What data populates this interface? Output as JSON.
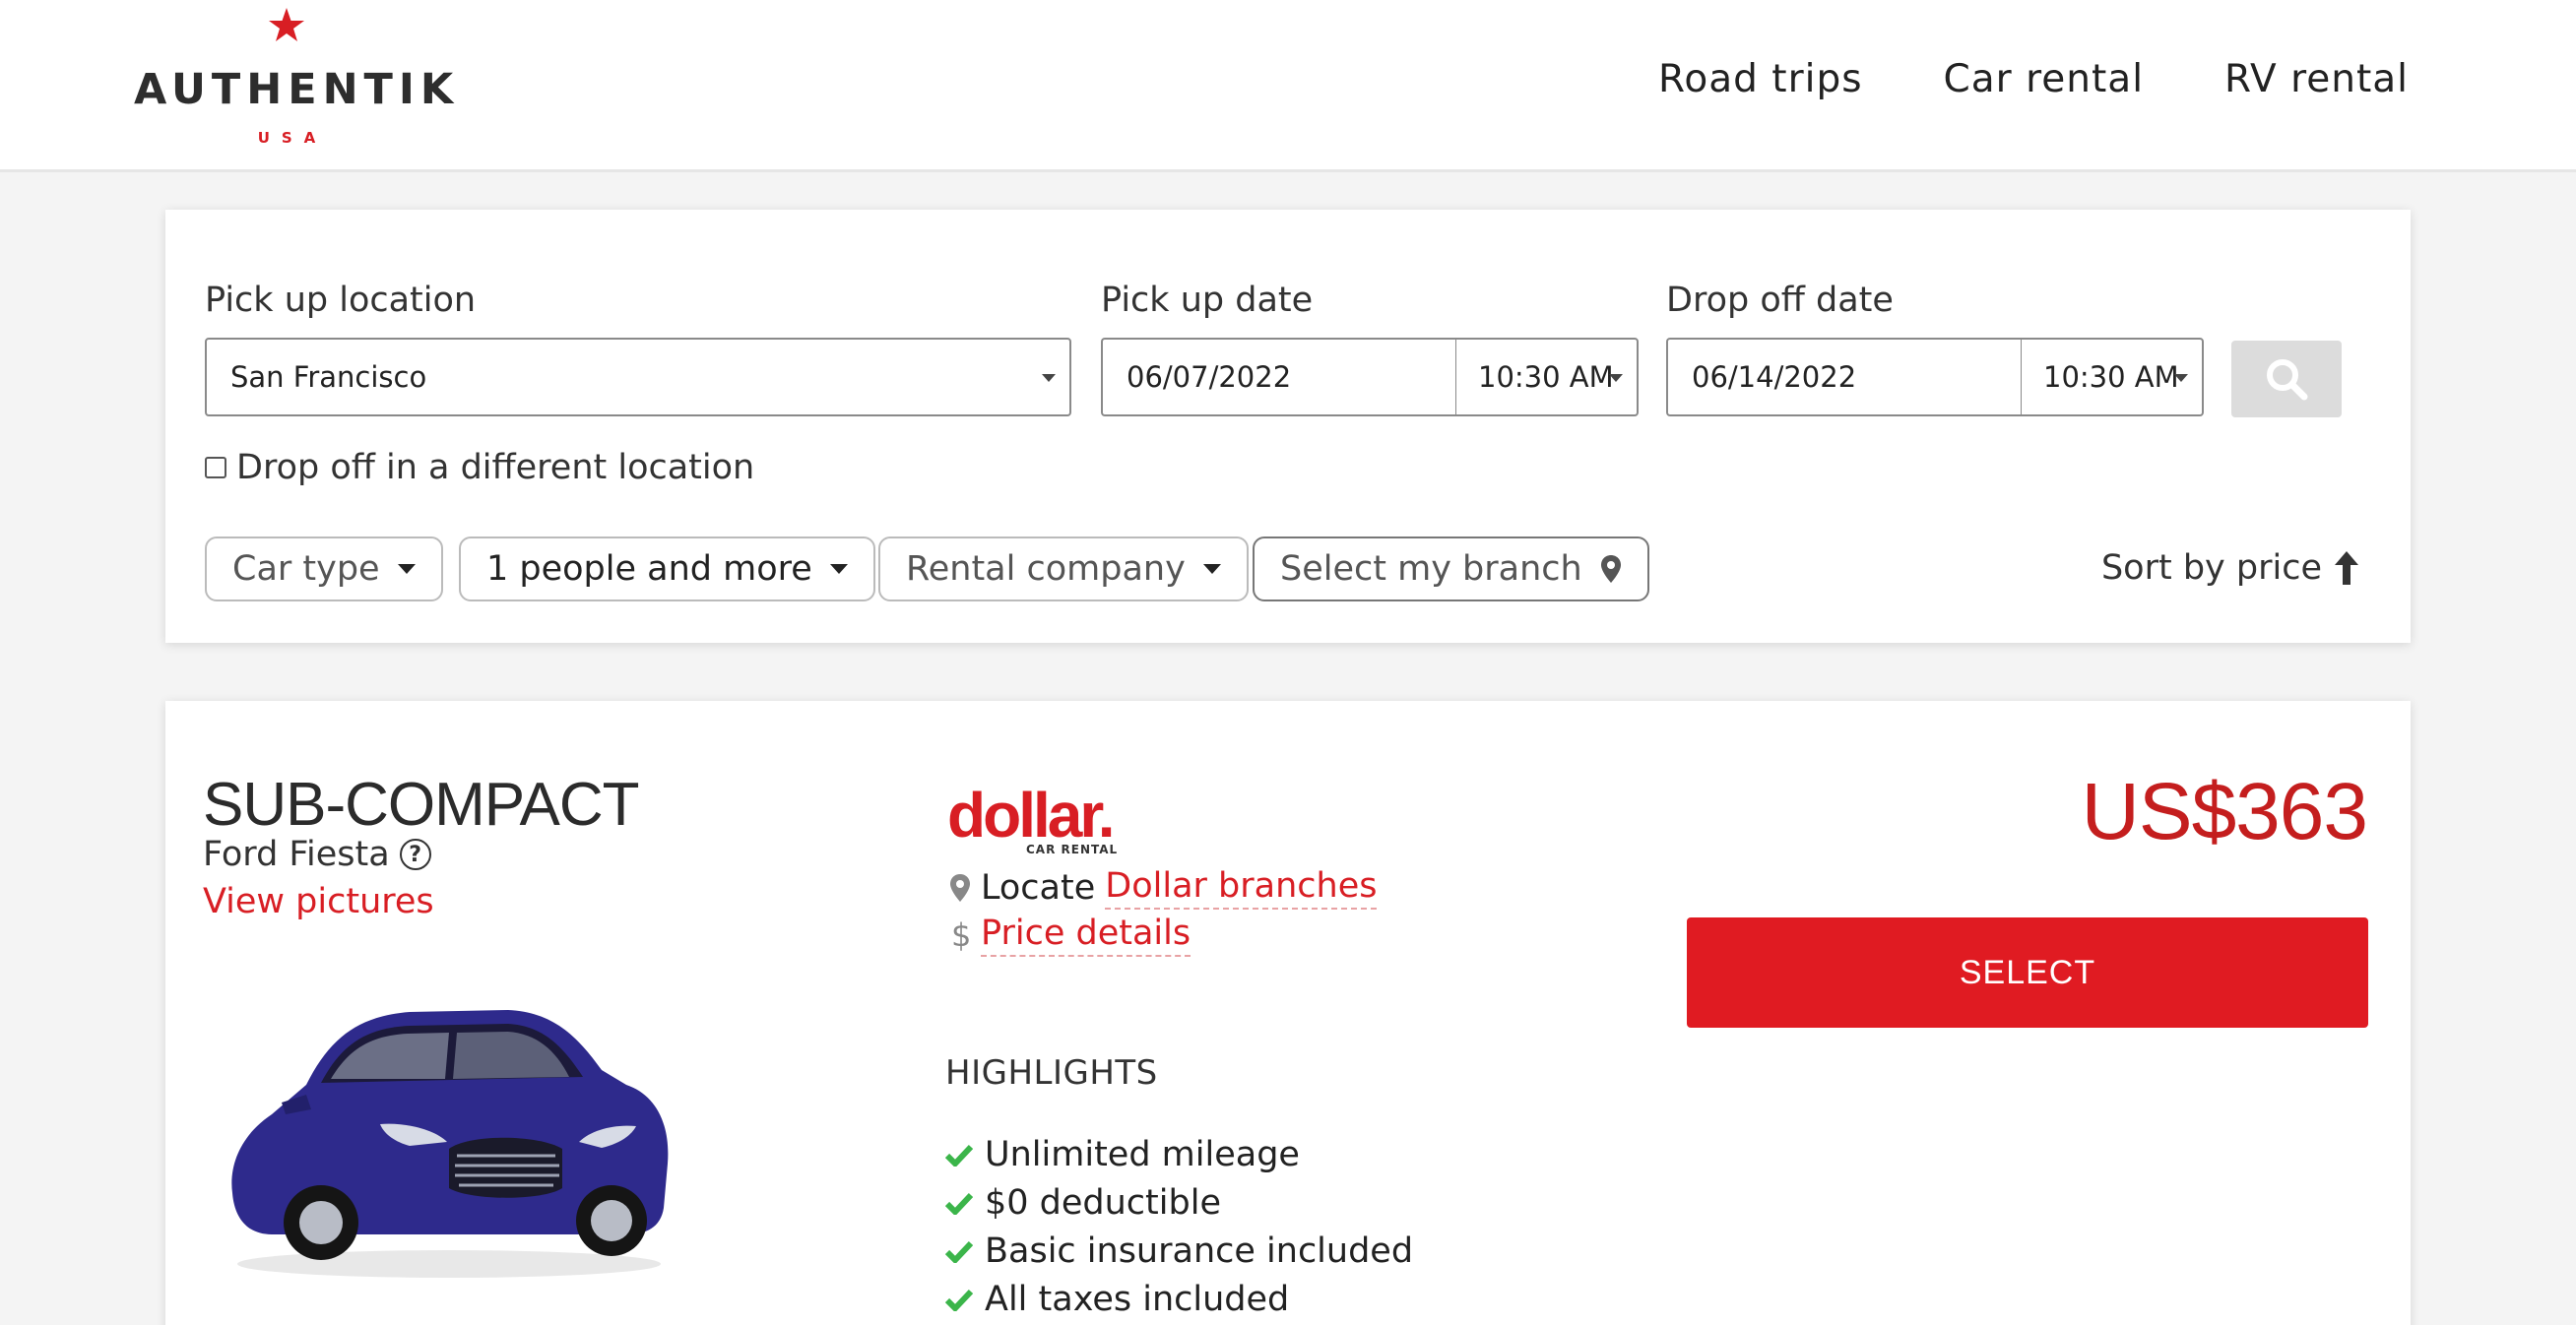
{
  "brand": {
    "name": "AUTHENTIK",
    "sub": "USA",
    "accent": "#d81e24"
  },
  "nav": {
    "items": [
      "Road trips",
      "Car rental",
      "RV rental"
    ]
  },
  "search": {
    "pickup_location_label": "Pick up location",
    "pickup_location_value": "San Francisco",
    "pickup_date_label": "Pick up date",
    "pickup_date_value": "06/07/2022",
    "pickup_time_value": "10:30 AM",
    "dropoff_date_label": "Drop off date",
    "dropoff_date_value": "06/14/2022",
    "dropoff_time_value": "10:30 AM",
    "different_location_label": "Drop off in a different location",
    "search_icon": "search-icon"
  },
  "filters": {
    "car_type": "Car type",
    "people": "1 people and more",
    "rental_company": "Rental company",
    "branch": "Select my branch",
    "sort": "Sort by price"
  },
  "result": {
    "car_class": "SUB-COMPACT",
    "car_model": "Ford Fiesta",
    "help_symbol": "?",
    "view_pictures": "View pictures",
    "company_logo_text": "dollar.",
    "company_logo_small": "CAR RENTAL",
    "locate_prefix": "Locate",
    "locate_link": "Dollar branches",
    "price_details": "Price details",
    "price": "US$363",
    "select_label": "SELECT",
    "highlights_title": "HIGHLIGHTS",
    "highlights": [
      "Unlimited mileage",
      "$0 deductible",
      "Basic insurance included",
      "All taxes included"
    ],
    "car_color": "#2e2a8c",
    "check_color": "#3bb54a"
  }
}
